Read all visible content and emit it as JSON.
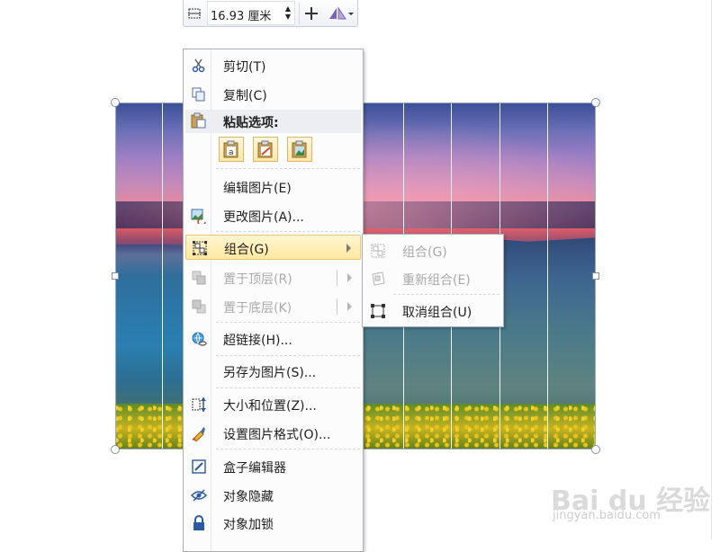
{
  "mini_toolbar": {
    "size_value": "16.93",
    "size_unit": "厘米",
    "spin_up": "▲",
    "spin_down": "▼"
  },
  "context_menu": {
    "cut": {
      "label": "剪切(T)",
      "icon": "scissors-icon"
    },
    "copy": {
      "label": "复制(C)",
      "icon": "copy-icon"
    },
    "paste_options": {
      "label": "粘贴选项:",
      "icon": "clipboard-icon"
    },
    "edit_picture": {
      "label": "编辑图片(E)"
    },
    "change_picture": {
      "label": "更改图片(A)...",
      "icon": "change-picture-icon"
    },
    "group": {
      "label": "组合(G)",
      "icon": "group-icon"
    },
    "bring_to_front": {
      "label": "置于顶层(R)",
      "icon": "bring-front-icon"
    },
    "send_to_back": {
      "label": "置于底层(K)",
      "icon": "send-back-icon"
    },
    "hyperlink": {
      "label": "超链接(H)...",
      "icon": "hyperlink-icon"
    },
    "save_as_picture": {
      "label": "另存为图片(S)..."
    },
    "size_position": {
      "label": "大小和位置(Z)...",
      "icon": "size-position-icon"
    },
    "format_picture": {
      "label": "设置图片格式(O)...",
      "icon": "format-picture-icon"
    },
    "box_editor": {
      "label": "盒子编辑器",
      "icon": "pencil-icon"
    },
    "hide_object": {
      "label": "对象隐藏",
      "icon": "eye-hidden-icon"
    },
    "lock_object": {
      "label": "对象加锁",
      "icon": "lock-icon"
    }
  },
  "group_submenu": {
    "group": {
      "label": "组合(G)"
    },
    "regroup": {
      "label": "重新组合(E)"
    },
    "ungroup": {
      "label": "取消组合(U)"
    }
  },
  "watermark": {
    "brand": "Bai du 经验",
    "url": "jingyan.baidu.com"
  },
  "colors": {
    "highlight": "#ffe8a2",
    "menu_border": "#a8b0bd",
    "disabled_text": "#a9a9a9"
  }
}
